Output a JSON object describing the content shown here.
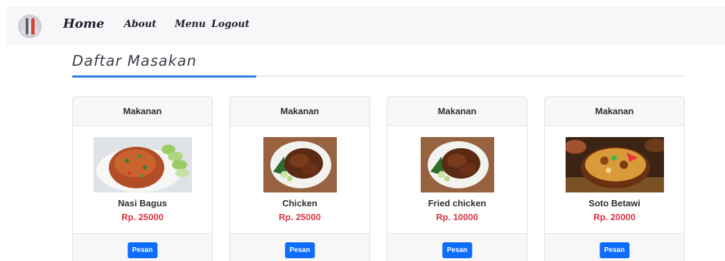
{
  "navbar": {
    "logo_icon": "restaurant-logo",
    "links": [
      {
        "label": "Home"
      },
      {
        "label": "About"
      },
      {
        "label": "Menu"
      },
      {
        "label": "Logout"
      }
    ]
  },
  "section": {
    "title": "Daftar Masakan",
    "accent_color": "#1c7ae0"
  },
  "cards": [
    {
      "header": "Makanan",
      "image": "nasi-goreng-photo",
      "name": "Nasi Bagus",
      "price": "Rp. 25000",
      "button": "Pesan"
    },
    {
      "header": "Makanan",
      "image": "chicken-photo",
      "name": "Chicken",
      "price": "Rp. 25000",
      "button": "Pesan"
    },
    {
      "header": "Makanan",
      "image": "fried-chicken-photo",
      "name": "Fried chicken",
      "price": "Rp. 10000",
      "button": "Pesan"
    },
    {
      "header": "Makanan",
      "image": "soto-betawi-photo",
      "name": "Soto Betawi",
      "price": "Rp. 20000",
      "button": "Pesan"
    }
  ],
  "colors": {
    "price": "#dc3545",
    "button": "#0d6efd"
  }
}
